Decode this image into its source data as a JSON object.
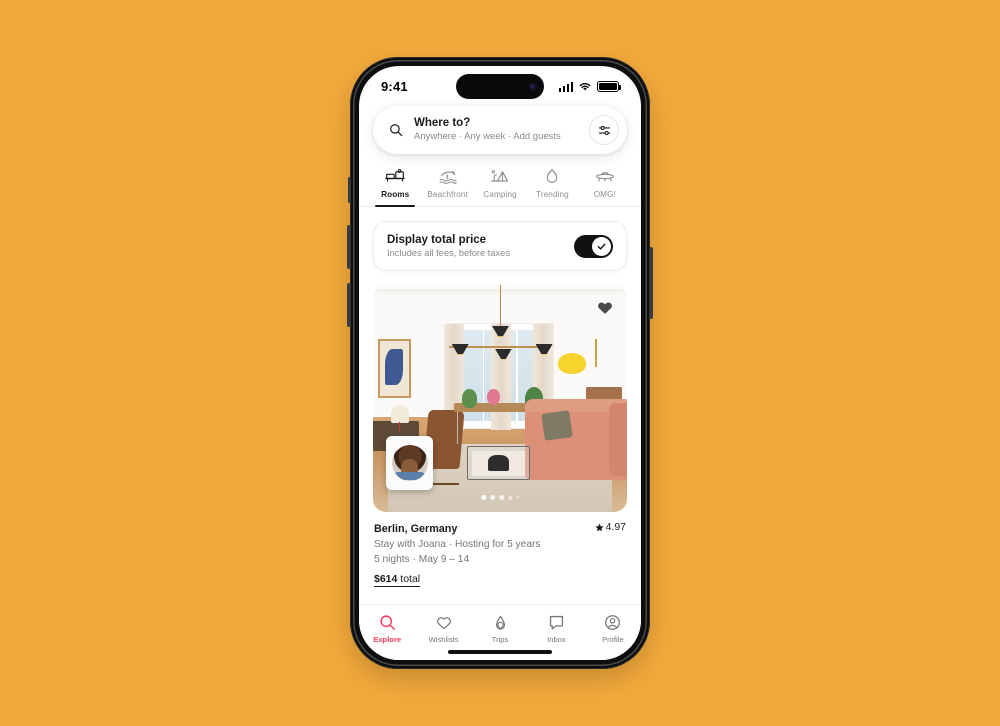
{
  "background_color": "#F2A93B",
  "accent_color": "#FF385C",
  "status_bar": {
    "time": "9:41",
    "signal_icon": "cellular-signal-icon",
    "wifi_icon": "wifi-icon",
    "battery_icon": "battery-icon"
  },
  "search": {
    "search_icon": "search-icon",
    "title": "Where to?",
    "subtitle": "Anywhere · Any week · Add guests",
    "placeholder": "Where to?",
    "filter_icon": "filter-sliders-icon"
  },
  "categories": [
    {
      "label": "Rooms",
      "icon": "bed-icon",
      "active": true
    },
    {
      "label": "Beachfront",
      "icon": "beach-icon",
      "active": false
    },
    {
      "label": "Camping",
      "icon": "tent-icon",
      "active": false
    },
    {
      "label": "Trending",
      "icon": "flame-icon",
      "active": false
    },
    {
      "label": "OMG!",
      "icon": "ufo-icon",
      "active": false
    }
  ],
  "total_price_toggle": {
    "title": "Display total price",
    "subtitle": "Includes all fees, before taxes",
    "enabled": true,
    "check_icon": "check-icon"
  },
  "listing": {
    "favorite_icon": "heart-icon",
    "host_avatar": "host-avatar",
    "photo_dots": 5,
    "active_dot": 1,
    "location": "Berlin, Germany",
    "rating": "4.97",
    "star_icon": "star-icon",
    "host_line": "Stay with Joana · Hosting for 5 years",
    "dates_line": "5 nights · May 9 – 14",
    "price_amount": "$614",
    "price_suffix": " total"
  },
  "tabbar": [
    {
      "label": "Explore",
      "icon": "search-icon",
      "active": true
    },
    {
      "label": "Wishlists",
      "icon": "heart-icon",
      "active": false
    },
    {
      "label": "Trips",
      "icon": "airbnb-icon",
      "active": false
    },
    {
      "label": "Inbox",
      "icon": "message-icon",
      "active": false
    },
    {
      "label": "Profile",
      "icon": "profile-icon",
      "active": false
    }
  ]
}
